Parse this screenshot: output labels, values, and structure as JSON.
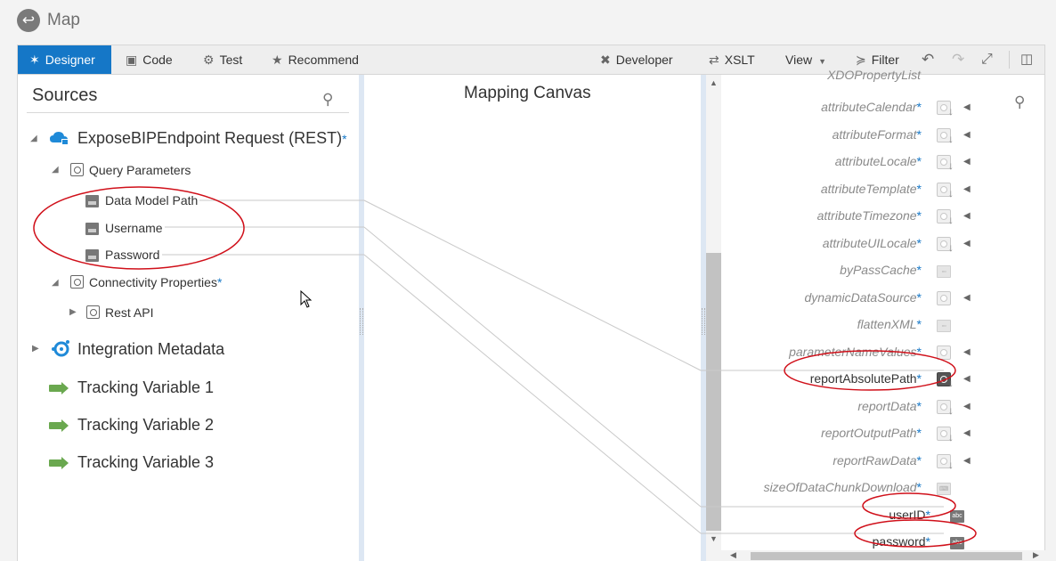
{
  "header": {
    "title": "Map"
  },
  "toolbar": {
    "designer": "Designer",
    "code": "Code",
    "test": "Test",
    "recommend": "Recommend",
    "developer": "Developer",
    "xslt": "XSLT",
    "view": "View",
    "filter": "Filter"
  },
  "sources": {
    "title": "Sources",
    "root": {
      "label": "ExposeBIPEndpoint Request (REST)",
      "required": "*"
    },
    "query_params": {
      "label": "Query Parameters"
    },
    "params": [
      "Data Model Path",
      "Username",
      "Password"
    ],
    "connectivity": {
      "label": "Connectivity Properties",
      "required": "*"
    },
    "rest_api": "Rest API",
    "others": [
      "Integration Metadata",
      "Tracking Variable 1",
      "Tracking Variable 2",
      "Tracking Variable 3"
    ]
  },
  "canvas": {
    "title": "Mapping Canvas"
  },
  "targets": {
    "partial_top": "XDOPropertyList",
    "items": [
      {
        "label": "attributeCalendar",
        "star": "*"
      },
      {
        "label": "attributeFormat",
        "star": "*"
      },
      {
        "label": "attributeLocale",
        "star": "*"
      },
      {
        "label": "attributeTemplate",
        "star": "*"
      },
      {
        "label": "attributeTimezone",
        "star": "*"
      },
      {
        "label": "attributeUILocale",
        "star": "*"
      },
      {
        "label": "byPassCache",
        "star": "*"
      },
      {
        "label": "dynamicDataSource",
        "star": "*"
      },
      {
        "label": "flattenXML",
        "star": "*"
      },
      {
        "label": "parameterNameValues",
        "star": "*"
      },
      {
        "label": "reportAbsolutePath",
        "star": "*"
      },
      {
        "label": "reportData",
        "star": "*"
      },
      {
        "label": "reportOutputPath",
        "star": "*"
      },
      {
        "label": "reportRawData",
        "star": "*"
      },
      {
        "label": "sizeOfDataChunkDownload",
        "star": "*"
      },
      {
        "label": "userID",
        "star": "*"
      },
      {
        "label": "password",
        "star": "*"
      }
    ],
    "abc_icon": "abc"
  },
  "colors": {
    "accent": "#1577c7",
    "annotation": "#d0101a",
    "tracking": "#6aa84f"
  }
}
